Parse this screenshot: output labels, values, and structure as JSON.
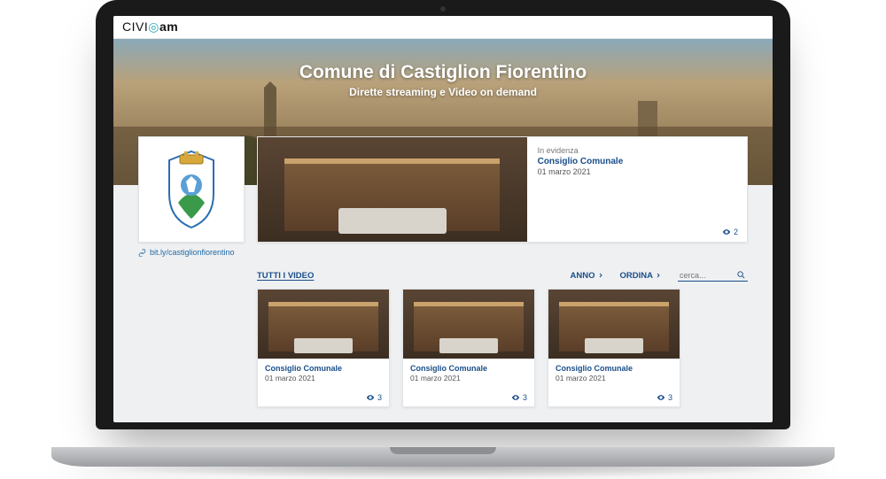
{
  "brand": {
    "part1": "CIVI",
    "part2": "am"
  },
  "hero": {
    "title": "Comune di Castiglion Fiorentino",
    "subtitle": "Dirette streaming e Video on demand"
  },
  "short_url": "bit.ly/castiglionfiorentino",
  "featured": {
    "tag": "In evidenza",
    "title": "Consiglio Comunale",
    "date": "01 marzo 2021",
    "views": "2"
  },
  "filters": {
    "all_label": "TUTTI I VIDEO",
    "year_label": "ANNO",
    "sort_label": "ORDINA",
    "search_placeholder": "cerca..."
  },
  "videos": [
    {
      "title": "Consiglio Comunale",
      "date": "01 marzo 2021",
      "views": "3"
    },
    {
      "title": "Consiglio Comunale",
      "date": "01 marzo 2021",
      "views": "3"
    },
    {
      "title": "Consiglio Comunale",
      "date": "01 marzo 2021",
      "views": "3"
    }
  ]
}
